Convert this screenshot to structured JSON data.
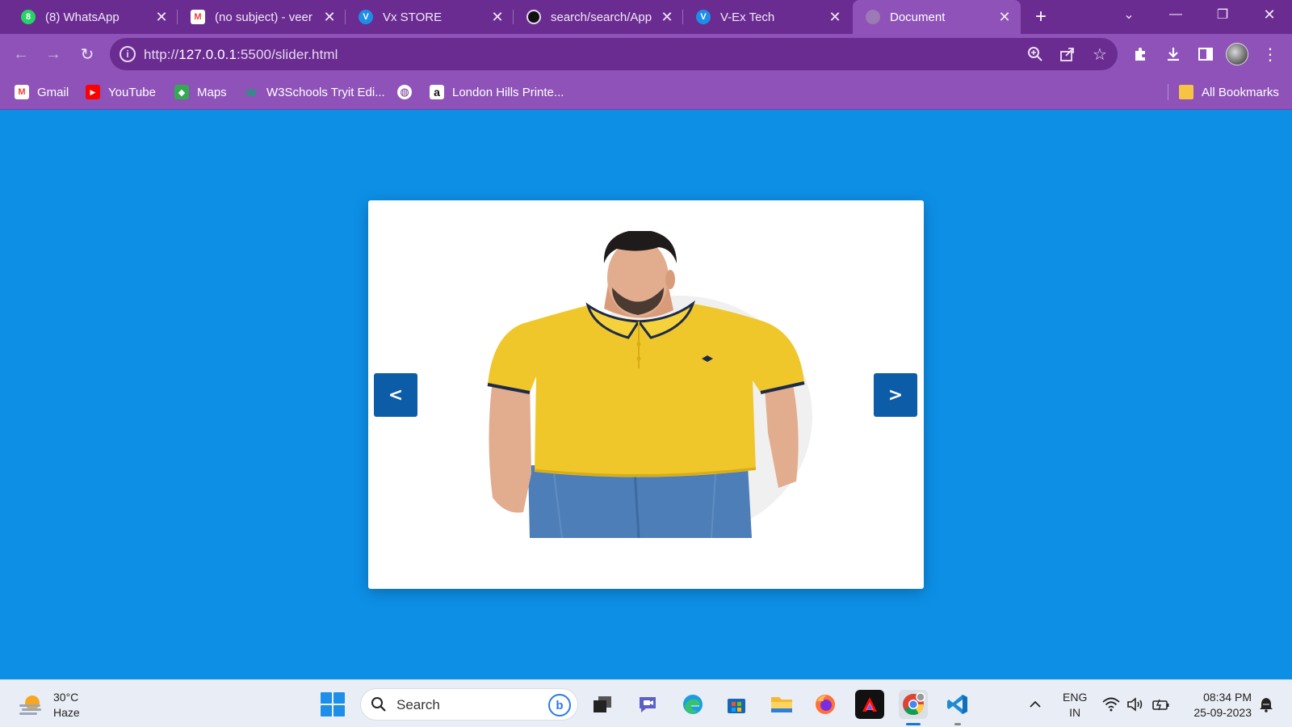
{
  "tabs": [
    {
      "title": "(8) WhatsApp",
      "icon": "whatsapp-icon",
      "color": "#25d366",
      "badge": "8"
    },
    {
      "title": "(no subject) - veer",
      "icon": "gmail-icon",
      "color": "#ea4335",
      "badge": "M"
    },
    {
      "title": "Vx STORE",
      "icon": "vx-icon",
      "color": "#1e8de8",
      "badge": "V"
    },
    {
      "title": "search/search/App",
      "icon": "github-icon",
      "color": "#222222",
      "badge": "●"
    },
    {
      "title": "V-Ex Tech",
      "icon": "vx-icon",
      "color": "#1e8de8",
      "badge": "V"
    },
    {
      "title": "Document",
      "icon": "globe-icon",
      "color": "#9c7ab5",
      "badge": "",
      "active": true
    }
  ],
  "address": {
    "url_prefix": "http://",
    "url_host": "127.0.0.1",
    "url_path": ":5500/slider.html"
  },
  "bookmarks": [
    {
      "label": "Gmail",
      "icon": "gmail-icon",
      "color": "#ea4335",
      "glyph": "M"
    },
    {
      "label": "YouTube",
      "icon": "youtube-icon",
      "color": "#ff0000",
      "glyph": "▶"
    },
    {
      "label": "Maps",
      "icon": "maps-icon",
      "color": "#34a853",
      "glyph": "◆"
    },
    {
      "label": "W3Schools Tryit Edi...",
      "icon": "w3schools-icon",
      "color": "#04aa6d",
      "glyph": "W"
    },
    {
      "label": "",
      "icon": "globe-icon",
      "color": "#ffffff",
      "glyph": "◍"
    },
    {
      "label": "London Hills Printe...",
      "icon": "amazon-icon",
      "color": "#ffffff",
      "glyph": "a"
    }
  ],
  "all_bookmarks": "All Bookmarks",
  "slider": {
    "prev_label": "<",
    "next_label": ">"
  },
  "taskbar": {
    "weather_temp": "30°C",
    "weather_desc": "Haze",
    "search_placeholder": "Search",
    "lang_line1": "ENG",
    "lang_line2": "IN",
    "time": "08:34 PM",
    "date": "25-09-2023"
  }
}
